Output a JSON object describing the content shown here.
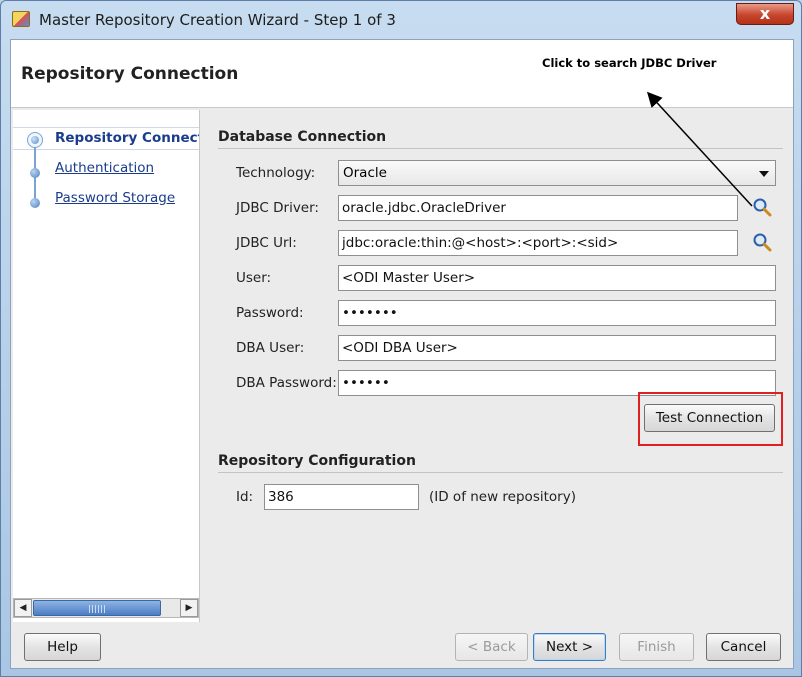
{
  "window": {
    "title": "Master Repository Creation Wizard - Step 1 of 3",
    "close_glyph": "x"
  },
  "header": {
    "title": "Repository Connection",
    "tooltip": "Click to search JDBC Driver"
  },
  "sidebar": {
    "items": [
      {
        "label": "Repository Connection",
        "current": true
      },
      {
        "label": "Authentication",
        "current": false
      },
      {
        "label": "Password Storage",
        "current": false
      }
    ],
    "scroll_left": "◀",
    "scroll_right": "▶"
  },
  "database_connection": {
    "section_title": "Database Connection",
    "technology": {
      "label": "Technology:",
      "value": "Oracle"
    },
    "jdbc_driver": {
      "label": "JDBC Driver:",
      "value": "oracle.jdbc.OracleDriver"
    },
    "jdbc_url": {
      "label": "JDBC Url:",
      "value": "jdbc:oracle:thin:@<host>:<port>:<sid>"
    },
    "user": {
      "label": "User:",
      "value": "<ODI Master User>"
    },
    "password": {
      "label": "Password:",
      "value": "•••••••"
    },
    "dba_user": {
      "label": "DBA User:",
      "value": "<ODI DBA User>"
    },
    "dba_password": {
      "label": "DBA Password:",
      "value": "••••••"
    },
    "test_connection_label": "Test Connection"
  },
  "repository_configuration": {
    "section_title": "Repository Configuration",
    "id": {
      "label": "Id:",
      "value": "386",
      "hint": "(ID of new repository)"
    }
  },
  "footer": {
    "help": "Help",
    "back": "< Back",
    "next": "Next >",
    "finish": "Finish",
    "cancel": "Cancel"
  },
  "icons": {
    "app": "wizard-app-icon",
    "search": "magnifier-search-icon",
    "dropdown": "chevron-down-icon"
  },
  "colors": {
    "highlight": "#e02020",
    "link": "#1a3c8c",
    "titlebar": "#c7dcf0"
  }
}
